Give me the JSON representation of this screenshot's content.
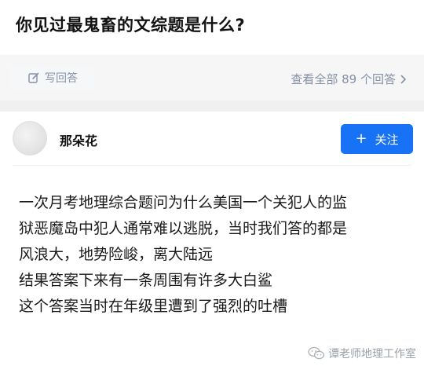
{
  "question": {
    "title": "你见过最鬼畜的文综题是什么?"
  },
  "actions": {
    "write_answer_label": "写回答",
    "view_all_label": "查看全部 89 个回答",
    "write_icon": "edit-icon",
    "chevron_icon": "chevron-right-icon"
  },
  "author": {
    "name": "那朵花",
    "follow_label": "关注",
    "follow_plus": "+",
    "follow_color": "#1772f6"
  },
  "answer": {
    "lines": [
      "一次月考地理综合题问为什么美国一个关犯人的监",
      "狱恶魔岛中犯人通常难以逃脱，当时我们答的都是",
      "风浪大，地势险峻，离大陆远",
      "结果答案下来有一条周围有许多大白鲨",
      "这个答案当时在年级里遭到了强烈的吐槽"
    ]
  },
  "watermark": {
    "text": "谭老师地理工作室",
    "icon": "wechat-icon"
  }
}
